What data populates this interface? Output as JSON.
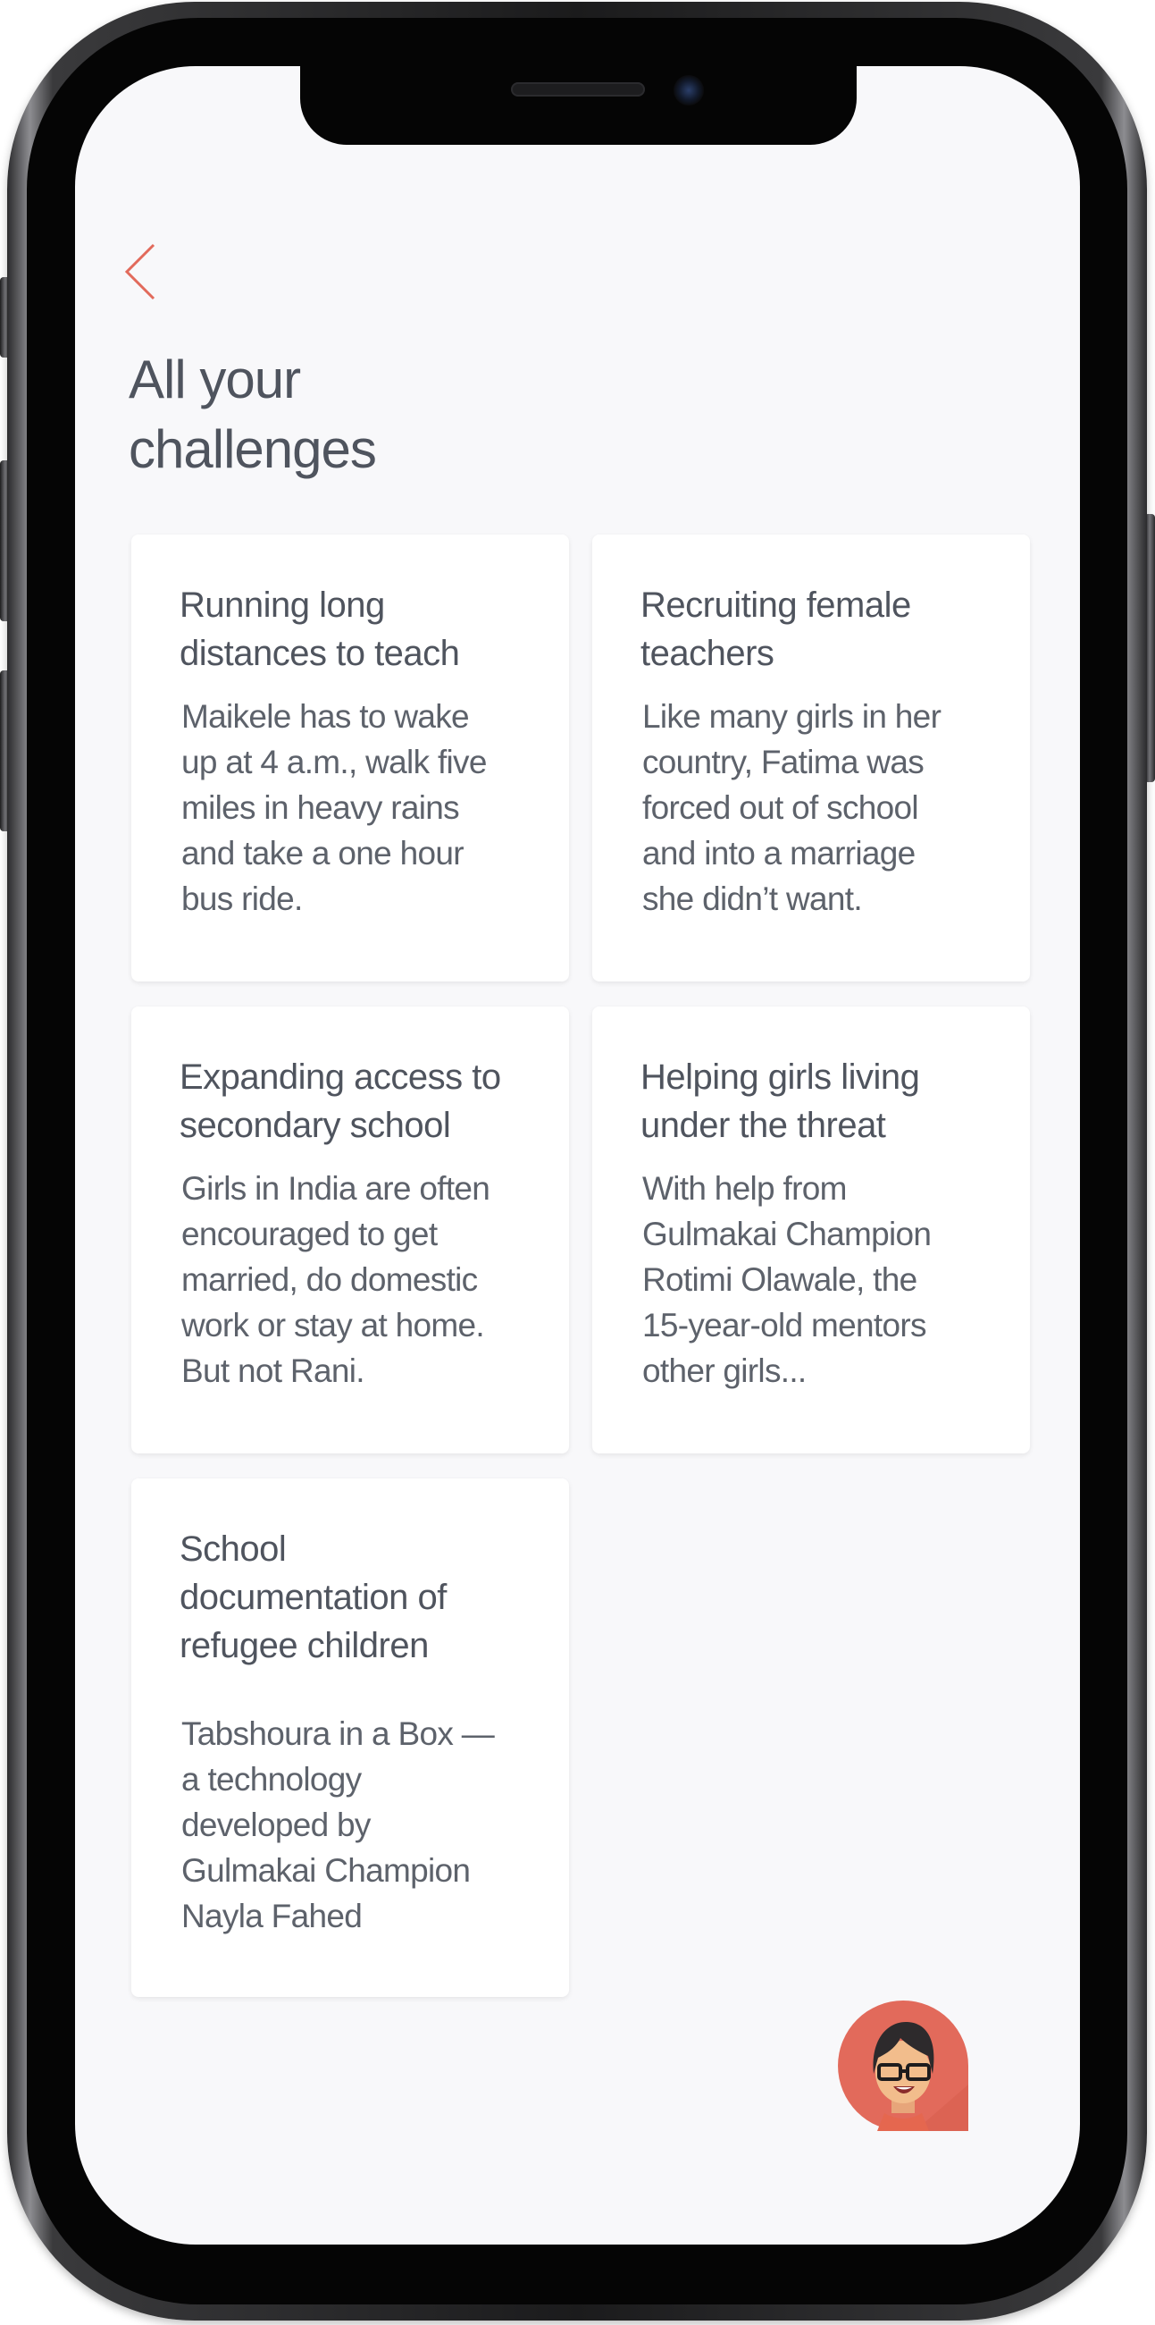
{
  "colors": {
    "accent": "#e26a5b",
    "text": "#4f545e",
    "background": "#f8f8fa",
    "card": "#ffffff"
  },
  "nav": {
    "back_icon": "chevron-left-icon"
  },
  "page": {
    "title": "All your\nchallenges"
  },
  "cards": [
    {
      "title": "Running long\ndistances to teach",
      "description": "Maikele has to wake\nup at 4 a.m., walk five\nmiles in heavy rains\nand take a one hour\nbus ride."
    },
    {
      "title": "Recruiting female\nteachers",
      "description": "Like many girls in her\ncountry, Fatima was\nforced out of school\nand into a marriage\nshe didn’t want."
    },
    {
      "title": "Expanding access to\nsecondary school",
      "description": "Girls in India are often\nencouraged to get\nmarried, do domestic\nwork or stay at home.\nBut not Rani."
    },
    {
      "title": "Helping girls living\nunder the threat",
      "description": "With help from\nGulmakai Champion\nRotimi Olawale, the\n15-year-old mentors\nother girls..."
    },
    {
      "title": "School\ndocumentation of\nrefugee children",
      "description": "Tabshoura in a Box —\na technology\ndeveloped by\nGulmakai Champion\nNayla Fahed"
    }
  ],
  "assistant": {
    "icon": "avatar-icon"
  }
}
